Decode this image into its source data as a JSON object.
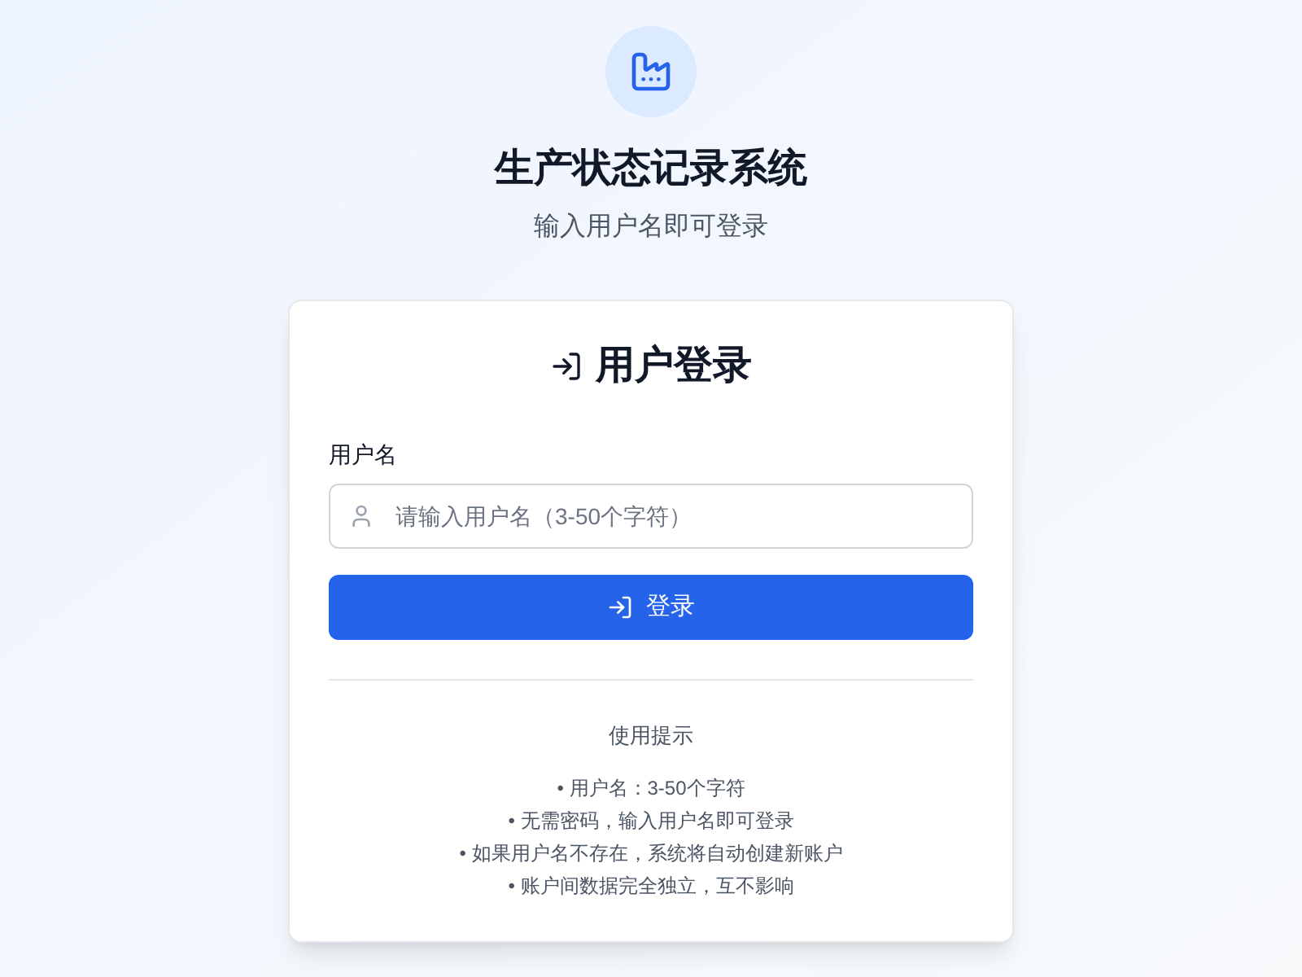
{
  "header": {
    "title": "生产状态记录系统",
    "subtitle": "输入用户名即可登录"
  },
  "card": {
    "title": "用户登录",
    "username_label": "用户名",
    "username_field": {
      "placeholder": "请输入用户名（3-50个字符）"
    },
    "login_button": "登录",
    "tips": {
      "title": "使用提示",
      "items": [
        "• 用户名：3-50个字符",
        "• 无需密码，输入用户名即可登录",
        "• 如果用户名不存在，系统将自动创建新账户",
        "• 账户间数据完全独立，互不影响"
      ]
    }
  }
}
